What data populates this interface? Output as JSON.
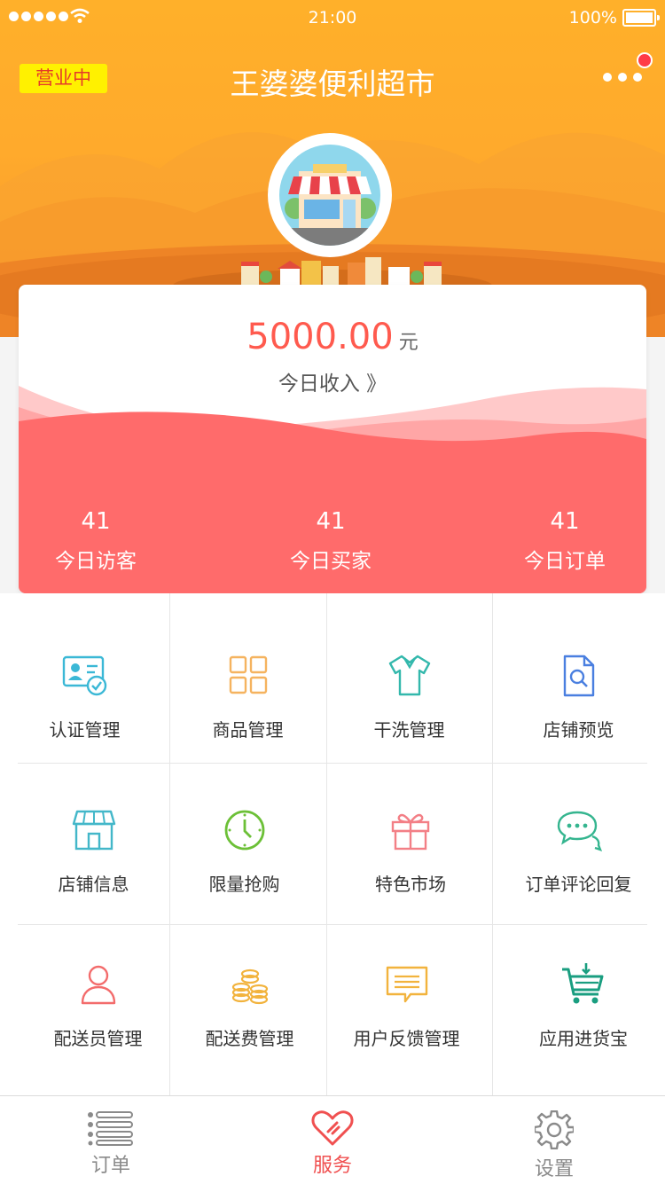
{
  "status_bar": {
    "time": "21:00",
    "battery": "100%"
  },
  "header": {
    "status_tag": "营业中",
    "store_name": "王婆婆便利超市"
  },
  "income_card": {
    "amount": "5000.00",
    "unit": "元",
    "label": "今日收入 》",
    "stats": [
      {
        "value": "41",
        "label": "今日访客"
      },
      {
        "value": "41",
        "label": "今日买家"
      },
      {
        "value": "41",
        "label": "今日订单"
      }
    ]
  },
  "menu": [
    {
      "label": "认证管理",
      "icon": "id-card-check-icon",
      "color": "#3bb8d6"
    },
    {
      "label": "商品管理",
      "icon": "grid-icon",
      "color": "#f5b35f"
    },
    {
      "label": "干洗管理",
      "icon": "shirt-icon",
      "color": "#33b8ac"
    },
    {
      "label": "店铺预览",
      "icon": "document-search-icon",
      "color": "#4a7fe0"
    },
    {
      "label": "店铺信息",
      "icon": "storefront-icon",
      "color": "#43b7c9"
    },
    {
      "label": "限量抢购",
      "icon": "clock-icon",
      "color": "#6cc037"
    },
    {
      "label": "特色市场",
      "icon": "gift-icon",
      "color": "#f37f86"
    },
    {
      "label": "订单评论回复",
      "icon": "chat-bubbles-icon",
      "color": "#35b58f"
    },
    {
      "label": "配送员管理",
      "icon": "person-icon",
      "color": "#f36c6c"
    },
    {
      "label": "配送费管理",
      "icon": "coins-icon",
      "color": "#f2b33d"
    },
    {
      "label": "用户反馈管理",
      "icon": "message-icon",
      "color": "#f2b33d"
    },
    {
      "label": "应用进货宝",
      "icon": "cart-icon",
      "color": "#1a9e80"
    }
  ],
  "tabs": [
    {
      "label": "订单",
      "icon": "list-icon",
      "color": "#8a8a8a"
    },
    {
      "label": "服务",
      "icon": "heart-icon",
      "color": "#f05050"
    },
    {
      "label": "设置",
      "icon": "gear-icon",
      "color": "#8a8a8a"
    }
  ]
}
